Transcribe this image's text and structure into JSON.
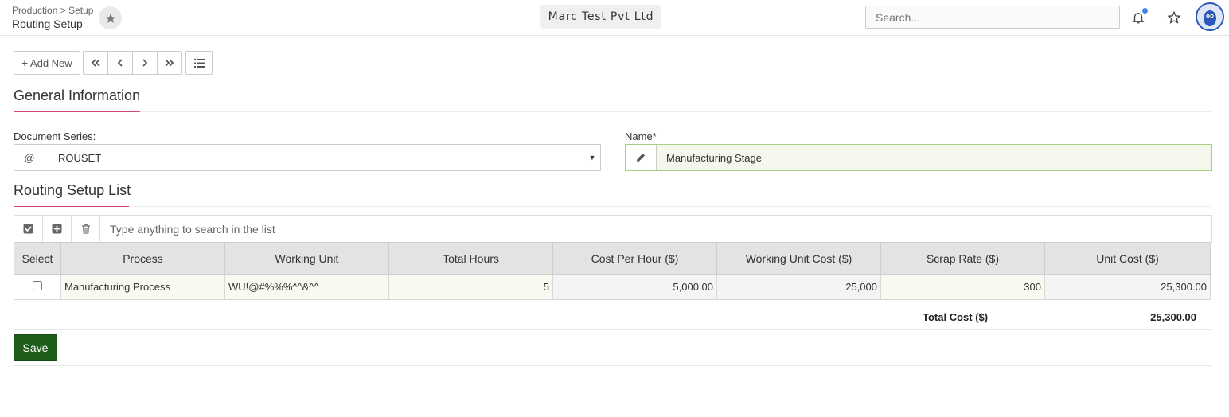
{
  "header": {
    "breadcrumb": "Production > Setup",
    "title": "Routing Setup",
    "company": "Marc Test Pvt Ltd",
    "search_placeholder": "Search..."
  },
  "toolbar": {
    "add_new_label": "Add New"
  },
  "general": {
    "heading": "General Information",
    "document_series_label": "Document Series:",
    "document_series_addon": "@",
    "document_series_value": "ROUSET",
    "name_label": "Name*",
    "name_value": "Manufacturing Stage"
  },
  "routing": {
    "heading": "Routing Setup List",
    "search_placeholder": "Type anything to search in the list",
    "columns": [
      "Select",
      "Process",
      "Working Unit",
      "Total Hours",
      "Cost Per Hour ($)",
      "Working Unit Cost ($)",
      "Scrap Rate ($)",
      "Unit Cost ($)"
    ],
    "rows": [
      {
        "process": "Manufacturing Process",
        "working_unit": "WU!@#%%%^^&^^",
        "total_hours": "5",
        "cost_per_hour": "5,000.00",
        "working_unit_cost": "25,000",
        "scrap_rate": "300",
        "unit_cost": "25,300.00"
      }
    ],
    "total_label": "Total Cost ($)",
    "total_value": "25,300.00"
  },
  "actions": {
    "save_label": "Save"
  },
  "colors": {
    "accent": "#d0487f",
    "save": "#1f5d1a",
    "notification_dot": "#3b86e8"
  }
}
